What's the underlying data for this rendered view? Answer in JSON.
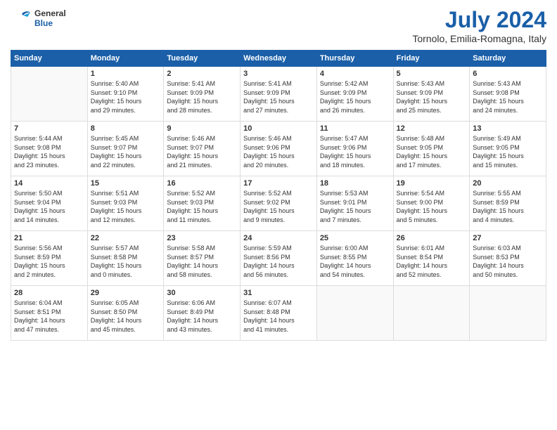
{
  "header": {
    "logo_line1": "General",
    "logo_line2": "Blue",
    "month_year": "July 2024",
    "location": "Tornolo, Emilia-Romagna, Italy"
  },
  "days_of_week": [
    "Sunday",
    "Monday",
    "Tuesday",
    "Wednesday",
    "Thursday",
    "Friday",
    "Saturday"
  ],
  "weeks": [
    [
      {
        "day": "",
        "content": ""
      },
      {
        "day": "1",
        "content": "Sunrise: 5:40 AM\nSunset: 9:10 PM\nDaylight: 15 hours\nand 29 minutes."
      },
      {
        "day": "2",
        "content": "Sunrise: 5:41 AM\nSunset: 9:09 PM\nDaylight: 15 hours\nand 28 minutes."
      },
      {
        "day": "3",
        "content": "Sunrise: 5:41 AM\nSunset: 9:09 PM\nDaylight: 15 hours\nand 27 minutes."
      },
      {
        "day": "4",
        "content": "Sunrise: 5:42 AM\nSunset: 9:09 PM\nDaylight: 15 hours\nand 26 minutes."
      },
      {
        "day": "5",
        "content": "Sunrise: 5:43 AM\nSunset: 9:09 PM\nDaylight: 15 hours\nand 25 minutes."
      },
      {
        "day": "6",
        "content": "Sunrise: 5:43 AM\nSunset: 9:08 PM\nDaylight: 15 hours\nand 24 minutes."
      }
    ],
    [
      {
        "day": "7",
        "content": "Sunrise: 5:44 AM\nSunset: 9:08 PM\nDaylight: 15 hours\nand 23 minutes."
      },
      {
        "day": "8",
        "content": "Sunrise: 5:45 AM\nSunset: 9:07 PM\nDaylight: 15 hours\nand 22 minutes."
      },
      {
        "day": "9",
        "content": "Sunrise: 5:46 AM\nSunset: 9:07 PM\nDaylight: 15 hours\nand 21 minutes."
      },
      {
        "day": "10",
        "content": "Sunrise: 5:46 AM\nSunset: 9:06 PM\nDaylight: 15 hours\nand 20 minutes."
      },
      {
        "day": "11",
        "content": "Sunrise: 5:47 AM\nSunset: 9:06 PM\nDaylight: 15 hours\nand 18 minutes."
      },
      {
        "day": "12",
        "content": "Sunrise: 5:48 AM\nSunset: 9:05 PM\nDaylight: 15 hours\nand 17 minutes."
      },
      {
        "day": "13",
        "content": "Sunrise: 5:49 AM\nSunset: 9:05 PM\nDaylight: 15 hours\nand 15 minutes."
      }
    ],
    [
      {
        "day": "14",
        "content": "Sunrise: 5:50 AM\nSunset: 9:04 PM\nDaylight: 15 hours\nand 14 minutes."
      },
      {
        "day": "15",
        "content": "Sunrise: 5:51 AM\nSunset: 9:03 PM\nDaylight: 15 hours\nand 12 minutes."
      },
      {
        "day": "16",
        "content": "Sunrise: 5:52 AM\nSunset: 9:03 PM\nDaylight: 15 hours\nand 11 minutes."
      },
      {
        "day": "17",
        "content": "Sunrise: 5:52 AM\nSunset: 9:02 PM\nDaylight: 15 hours\nand 9 minutes."
      },
      {
        "day": "18",
        "content": "Sunrise: 5:53 AM\nSunset: 9:01 PM\nDaylight: 15 hours\nand 7 minutes."
      },
      {
        "day": "19",
        "content": "Sunrise: 5:54 AM\nSunset: 9:00 PM\nDaylight: 15 hours\nand 5 minutes."
      },
      {
        "day": "20",
        "content": "Sunrise: 5:55 AM\nSunset: 8:59 PM\nDaylight: 15 hours\nand 4 minutes."
      }
    ],
    [
      {
        "day": "21",
        "content": "Sunrise: 5:56 AM\nSunset: 8:59 PM\nDaylight: 15 hours\nand 2 minutes."
      },
      {
        "day": "22",
        "content": "Sunrise: 5:57 AM\nSunset: 8:58 PM\nDaylight: 15 hours\nand 0 minutes."
      },
      {
        "day": "23",
        "content": "Sunrise: 5:58 AM\nSunset: 8:57 PM\nDaylight: 14 hours\nand 58 minutes."
      },
      {
        "day": "24",
        "content": "Sunrise: 5:59 AM\nSunset: 8:56 PM\nDaylight: 14 hours\nand 56 minutes."
      },
      {
        "day": "25",
        "content": "Sunrise: 6:00 AM\nSunset: 8:55 PM\nDaylight: 14 hours\nand 54 minutes."
      },
      {
        "day": "26",
        "content": "Sunrise: 6:01 AM\nSunset: 8:54 PM\nDaylight: 14 hours\nand 52 minutes."
      },
      {
        "day": "27",
        "content": "Sunrise: 6:03 AM\nSunset: 8:53 PM\nDaylight: 14 hours\nand 50 minutes."
      }
    ],
    [
      {
        "day": "28",
        "content": "Sunrise: 6:04 AM\nSunset: 8:51 PM\nDaylight: 14 hours\nand 47 minutes."
      },
      {
        "day": "29",
        "content": "Sunrise: 6:05 AM\nSunset: 8:50 PM\nDaylight: 14 hours\nand 45 minutes."
      },
      {
        "day": "30",
        "content": "Sunrise: 6:06 AM\nSunset: 8:49 PM\nDaylight: 14 hours\nand 43 minutes."
      },
      {
        "day": "31",
        "content": "Sunrise: 6:07 AM\nSunset: 8:48 PM\nDaylight: 14 hours\nand 41 minutes."
      },
      {
        "day": "",
        "content": ""
      },
      {
        "day": "",
        "content": ""
      },
      {
        "day": "",
        "content": ""
      }
    ]
  ]
}
